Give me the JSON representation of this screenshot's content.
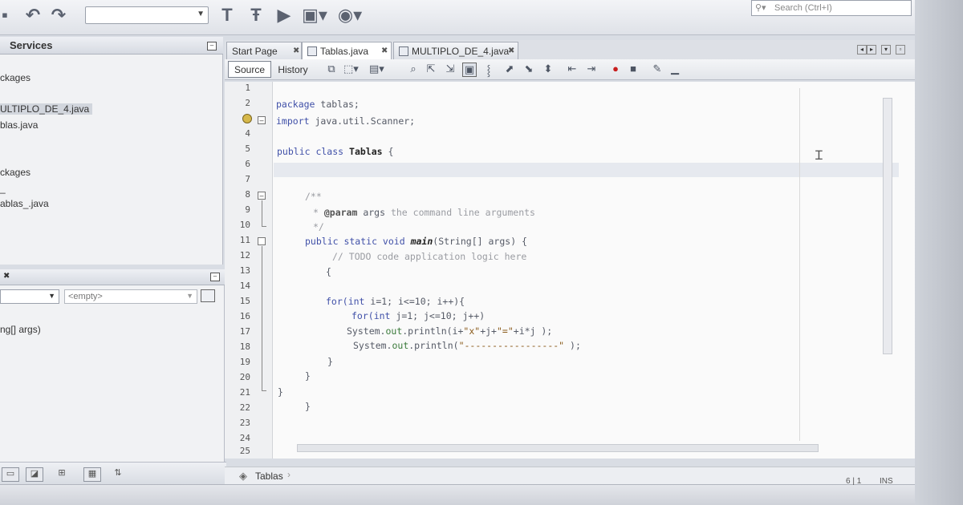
{
  "toolbar": {
    "icons": [
      "save-icon",
      "undo-icon",
      "redo-icon",
      "build-icon",
      "clean-build-icon",
      "run-icon",
      "debug-icon",
      "profile-icon"
    ],
    "search_placeholder": "Search (Ctrl+I)"
  },
  "services_panel": {
    "title": "Services",
    "items": [
      "ckages",
      "ULTIPLO_DE_4.java",
      "blas.java",
      "ckages",
      "_",
      "ablas_.java"
    ],
    "selected_index": 1
  },
  "navigator": {
    "combo_value": "<empty>",
    "members": [
      "ng[] args)"
    ]
  },
  "editor_tabs": [
    {
      "label": "Start Page"
    },
    {
      "label": "Tablas.java"
    },
    {
      "label": "MULTIPLO_DE_4.java"
    }
  ],
  "editor_toolbar": {
    "source_label": "Source",
    "history_label": "History"
  },
  "code": {
    "line_numbers": [
      "1",
      "2",
      "3",
      "4",
      "5",
      "6",
      "7",
      "8",
      "9",
      "10",
      "11",
      "12",
      "13",
      "14",
      "15",
      "16",
      "17",
      "18",
      "19",
      "20",
      "21",
      "22",
      "23",
      "24",
      "25"
    ],
    "l2_kw": "package",
    "l2_rest": " tablas;",
    "l3_kw": "import",
    "l3_rest": " java.util.Scanner;",
    "l5_kw": "public class",
    "l5_name": "Tablas",
    "l5_rest": " {",
    "l8": "/**",
    "l9_a": "* ",
    "l9_tag": "@param",
    "l9_arg": " args",
    "l9_b": " the command line arguments",
    "l10": "*/",
    "l11_kw": "public static void",
    "l11_name": "main",
    "l11_rest": "(String[] args) {",
    "l12": "// TODO code application logic here",
    "l13": "{",
    "l15_kw": "for(int",
    "l15_rest": " i=1; i<=10; i++){",
    "l16_kw": "for(int",
    "l16_rest": " j=1; j<=10; j++)",
    "l17_a": "System.",
    "l17_fld": "out",
    "l17_b": ".println(i+",
    "l17_s1": "\"x\"",
    "l17_c": "+j+",
    "l17_s2": "\"=\"",
    "l17_d": "+i*j );",
    "l18_a": "System.",
    "l18_fld": "out",
    "l18_b": ".println(",
    "l18_s": "\"-----------------\"",
    "l18_c": " );",
    "l19": "}",
    "l20": "}",
    "l21": "}",
    "l22": "}"
  },
  "breadcrumb": "Tablas",
  "status": {
    "position": "6 | 1",
    "mode": "INS"
  }
}
